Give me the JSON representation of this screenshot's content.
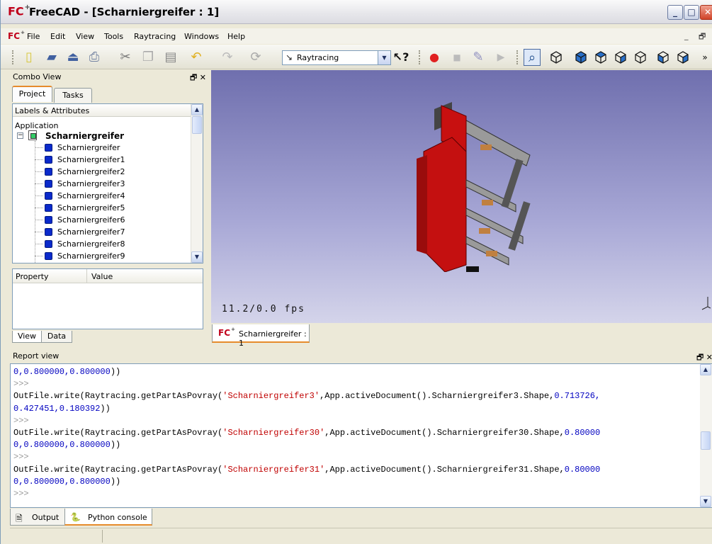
{
  "window": {
    "title": "FreeCAD - [Scharniergreifer : 1]",
    "logo_text": "FC",
    "logo_sup": "+",
    "minimize": "_",
    "maximize": "□",
    "close": "✕"
  },
  "menu": {
    "items": [
      "File",
      "Edit",
      "View",
      "Tools",
      "Raytracing",
      "Windows",
      "Help"
    ],
    "mdi_min": "_",
    "mdi_restore": "🗗"
  },
  "toolbar": {
    "workbench": "Raytracing",
    "icons": [
      "new-icon",
      "open-icon",
      "save-icon",
      "print-icon",
      "cut-icon",
      "copy-icon",
      "paste-icon",
      "undo-icon",
      "redo-icon",
      "refresh-icon",
      "whats-this-icon",
      "record-macro-icon",
      "stop-macro-icon",
      "edit-macro-icon",
      "run-macro-icon",
      "fit-all-icon",
      "axometric-icon",
      "front-icon",
      "top-icon",
      "right-icon",
      "rear-icon",
      "bottom-icon"
    ],
    "overflow": "»"
  },
  "combo": {
    "title": "Combo View",
    "float_close": "🗗 ✕",
    "tabs": [
      "Project",
      "Tasks"
    ],
    "tree_header": "Labels & Attributes",
    "app_label": "Application",
    "document": "Scharniergreifer",
    "items": [
      "Scharniergreifer",
      "Scharniergreifer1",
      "Scharniergreifer2",
      "Scharniergreifer3",
      "Scharniergreifer4",
      "Scharniergreifer5",
      "Scharniergreifer6",
      "Scharniergreifer7",
      "Scharniergreifer8",
      "Scharniergreifer9"
    ],
    "prop_col1": "Property",
    "prop_col2": "Value",
    "bottom_tabs": [
      "View",
      "Data"
    ]
  },
  "view3d": {
    "fps": "11.2/0.0 fps",
    "doc_tab": "Scharniergreifer : 1",
    "colors": {
      "background_top": "#6f6fae",
      "background_bottom": "#d4d4ea",
      "part_red": "#cc1010",
      "part_grey": "#8c8c8c"
    }
  },
  "report": {
    "title": "Report view",
    "float_close": "🗗 ✕",
    "lines": [
      [
        [
          "num",
          "0,0.800000,0.800000"
        ],
        [
          "",
          "))"
        ]
      ],
      [
        [
          "prompt",
          ">>>"
        ]
      ],
      [
        [
          "",
          "OutFile.write(Raytracing.getPartAsPovray("
        ],
        [
          "str",
          "'Scharniergreifer3'"
        ],
        [
          "",
          ",App.activeDocument().Scharniergreifer3.Shape,"
        ],
        [
          "num",
          "0.713726,"
        ]
      ],
      [
        [
          "num",
          "0.427451,0.180392"
        ],
        [
          "",
          "))"
        ]
      ],
      [
        [
          "prompt",
          ">>>"
        ]
      ],
      [
        [
          "",
          "OutFile.write(Raytracing.getPartAsPovray("
        ],
        [
          "str",
          "'Scharniergreifer30'"
        ],
        [
          "",
          ",App.activeDocument().Scharniergreifer30.Shape,"
        ],
        [
          "num",
          "0.80000"
        ]
      ],
      [
        [
          "num",
          "0,0.800000,0.800000"
        ],
        [
          "",
          "))"
        ]
      ],
      [
        [
          "prompt",
          ">>>"
        ]
      ],
      [
        [
          "",
          "OutFile.write(Raytracing.getPartAsPovray("
        ],
        [
          "str",
          "'Scharniergreifer31'"
        ],
        [
          "",
          ",App.activeDocument().Scharniergreifer31.Shape,"
        ],
        [
          "num",
          "0.80000"
        ]
      ],
      [
        [
          "num",
          "0,0.800000,0.800000"
        ],
        [
          "",
          "))"
        ]
      ],
      [
        [
          "prompt",
          ">>>"
        ]
      ]
    ],
    "tabs": [
      "Output",
      "Python console"
    ]
  }
}
